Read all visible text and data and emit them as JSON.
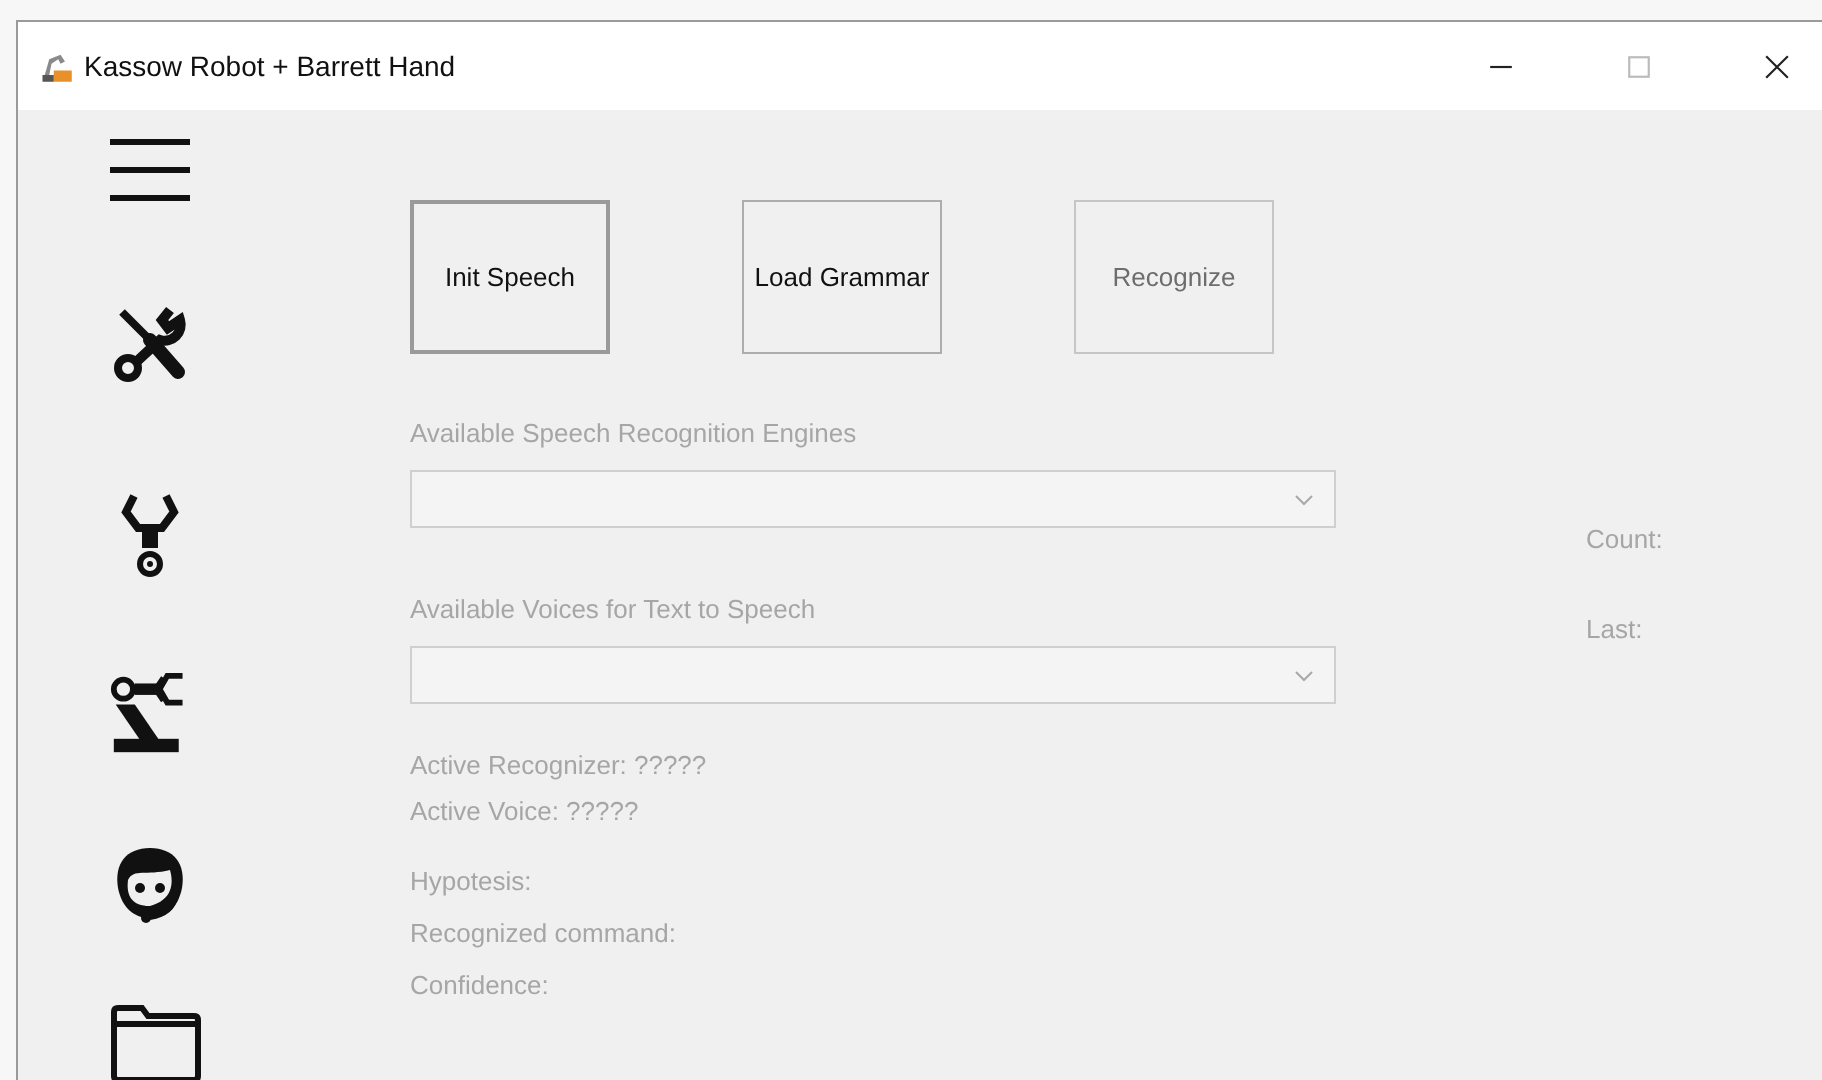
{
  "window": {
    "title": "Kassow Robot + Barrett Hand"
  },
  "buttons": [
    {
      "label": "Init Speech",
      "focused": true,
      "disabled": false
    },
    {
      "label": "Load Grammar",
      "focused": false,
      "disabled": false
    },
    {
      "label": "Recognize",
      "focused": false,
      "disabled": true
    }
  ],
  "dropdowns": [
    {
      "label": "Available Speech Recognition Engines",
      "disabled": true
    },
    {
      "label": "Available Voices for Text to Speech",
      "disabled": true
    }
  ],
  "status_lines": [
    "Active Recognizer: ?????",
    "Active Voice: ?????"
  ],
  "result_lines": [
    "Hypotesis:",
    "Recognized command:",
    "Confidence:"
  ],
  "counters": [
    "Count:",
    "Last:"
  ]
}
